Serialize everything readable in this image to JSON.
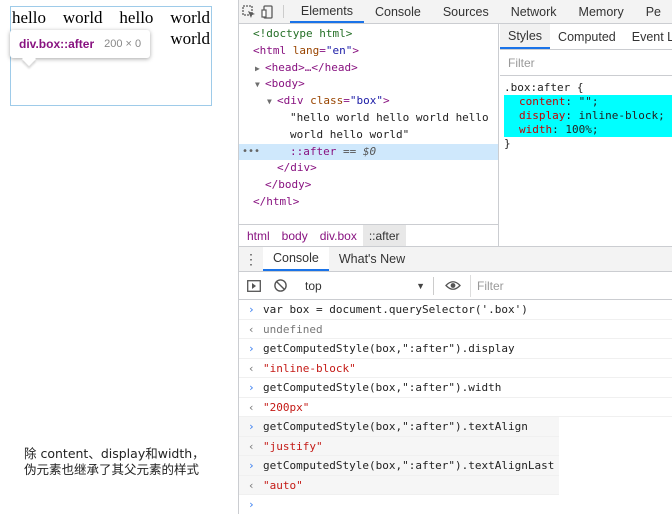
{
  "preview": {
    "box_words": [
      "hello",
      "world",
      "hello",
      "world"
    ],
    "box_line2": "world",
    "tooltip_selector": "div.box::after",
    "tooltip_dims": "200 × 0",
    "note_line1": "除 content、display和width，",
    "note_line2": "伪元素也继承了其父元素的样式"
  },
  "devtools": {
    "tabs": [
      "Elements",
      "Console",
      "Sources",
      "Network",
      "Memory",
      "Pe"
    ],
    "active_tab": "Elements",
    "dom": {
      "doctype": "<!doctype html>",
      "html_open_tag": "<html ",
      "html_attr": "lang",
      "html_attr_val": "\"en\"",
      "head": "<head>…</head>",
      "body_open": "<body>",
      "div_tag": "<div ",
      "div_attr": "class",
      "div_attr_val": "\"box\"",
      "text1": "\"hello world hello world hello",
      "text2": "world hello world\"",
      "after": "::after",
      "after_eq": " == $0",
      "div_close": "</div>",
      "body_close": "</body>",
      "html_close": "</html>"
    },
    "breadcrumbs": [
      "html",
      "body",
      "div.box",
      "::after"
    ],
    "styles_tabs": [
      "Styles",
      "Computed",
      "Event L"
    ],
    "styles_filter_placeholder": "Filter",
    "rule_selector": ".box:after {",
    "rule_props": [
      {
        "name": "content",
        "value": " \"\";"
      },
      {
        "name": "display",
        "value": " inline-block;"
      },
      {
        "name": "width",
        "value": " 100%;"
      }
    ],
    "rule_close": "}",
    "drawer_tabs": [
      "Console",
      "What's New"
    ],
    "context": "top",
    "console_filter": "Filter",
    "console": [
      {
        "kind": "in",
        "text": "var box = document.querySelector('.box')"
      },
      {
        "kind": "out",
        "text": "undefined"
      },
      {
        "kind": "in",
        "text": "getComputedStyle(box,\":after\").display"
      },
      {
        "kind": "res",
        "text": "\"inline-block\""
      },
      {
        "kind": "in",
        "text": "getComputedStyle(box,\":after\").width"
      },
      {
        "kind": "res",
        "text": "\"200px\""
      },
      {
        "kind": "in",
        "text": "getComputedStyle(box,\":after\").textAlign"
      },
      {
        "kind": "res",
        "text": "\"justify\""
      },
      {
        "kind": "in",
        "text": "getComputedStyle(box,\":after\").textAlignLast"
      },
      {
        "kind": "res",
        "text": "\"auto\""
      }
    ]
  }
}
